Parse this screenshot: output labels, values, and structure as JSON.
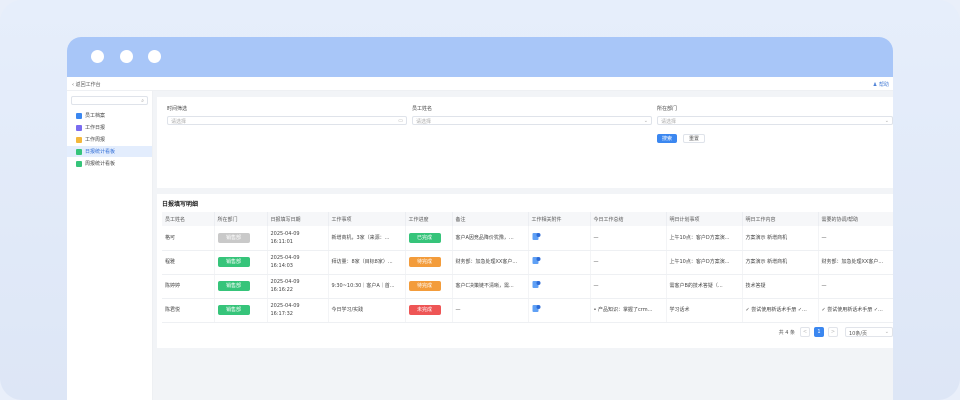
{
  "crumb": {
    "back_icon": "chevron-left-icon",
    "label": "返回工作台",
    "help": "帮助"
  },
  "sidebar": {
    "items": [
      {
        "label": "员工档案",
        "color": "#3b87f0",
        "active": false
      },
      {
        "label": "工作日报",
        "color": "#7a6cf0",
        "active": false
      },
      {
        "label": "工作周报",
        "color": "#f3b73b",
        "active": false
      },
      {
        "label": "日报统计看板",
        "color": "#36c47a",
        "active": true
      },
      {
        "label": "周报统计看板",
        "color": "#36c47a",
        "active": false
      }
    ]
  },
  "filters": {
    "time": {
      "label": "时间筛选",
      "placeholder": "请选择"
    },
    "employee": {
      "label": "员工姓名",
      "placeholder": "请选择"
    },
    "dept": {
      "label": "所在部门",
      "placeholder": "请选择"
    },
    "search_label": "搜索",
    "reset_label": "重置"
  },
  "table": {
    "title": "日报填写明细",
    "headers": [
      "员工姓名",
      "所在部门",
      "日报填写日期",
      "工作事项",
      "工作进度",
      "备注",
      "工作相关附件",
      "今日工作总结",
      "明日计划事项",
      "明日工作内容",
      "需要的协调/帮助"
    ],
    "rows": [
      {
        "name": "格可",
        "dept": "销售部",
        "dept_color": "grey",
        "date": "2025-04-09",
        "time": "16:11:01",
        "task": "新增商机，3家（来源：...",
        "progress": "已完成",
        "progress_color": "green",
        "note": "客户A因竞品降价犹豫，...",
        "summary": "—",
        "plan": "上午10点：客户D方案演...",
        "plan_content": "方案演示 新增商机",
        "help": "—"
      },
      {
        "name": "程雅",
        "dept": "销售部",
        "dept_color": "green",
        "date": "2025-04-09",
        "time": "16:14:03",
        "task": "拜访量：8家（目标8家）...",
        "progress": "待完成",
        "progress_color": "orange",
        "note": "财务部：加急处理XX客户...",
        "summary": "—",
        "plan": "上午10点：客户D方案演...",
        "plan_content": "方案演示 新增商机",
        "help": "财务部：加急处理XX客户..."
      },
      {
        "name": "陈婷婷",
        "dept": "销售部",
        "dept_color": "green",
        "date": "2025-04-09",
        "time": "16:16:22",
        "task": "9:30~10:30｜客户A｜首...",
        "progress": "待完成",
        "progress_color": "orange",
        "note": "客户C决策链不清晰，需...",
        "summary": "—",
        "plan": "需客户B的技术答疑（...",
        "plan_content": "技术答疑",
        "help": "—"
      },
      {
        "name": "陈君悦",
        "dept": "销售部",
        "dept_color": "green",
        "date": "2025-04-09",
        "time": "16:17:32",
        "task": "今日学习/实践",
        "progress": "未完成",
        "progress_color": "red",
        "note": "—",
        "summary": "• 产品知识：掌握了crm...",
        "plan": "学习话术",
        "plan_content": "✓ 尝试使用新话术手册 ✓...",
        "help": "✓ 尝试使用新话术手册 ✓..."
      }
    ]
  },
  "pager": {
    "total": "共 4 条",
    "current": "1",
    "prev": "<",
    "next": ">",
    "page_size": "10条/页"
  }
}
